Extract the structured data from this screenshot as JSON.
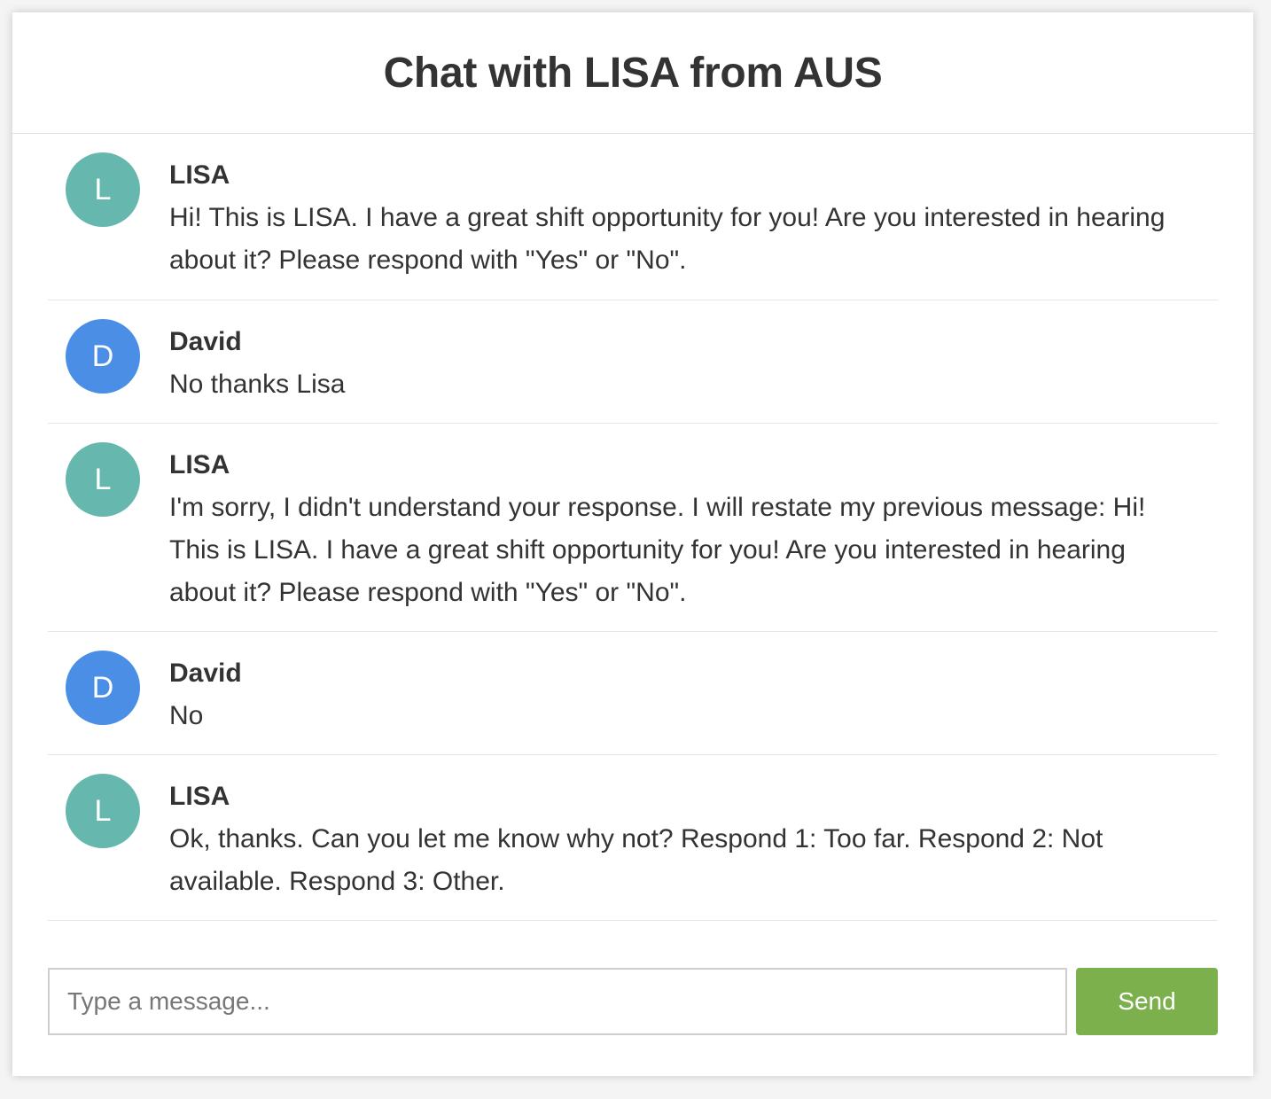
{
  "header": {
    "title": "Chat with LISA from AUS"
  },
  "colors": {
    "lisa_avatar": "#66b7ae",
    "david_avatar": "#4a8ee6",
    "send_button": "#7bb04c"
  },
  "messages": [
    {
      "initial": "L",
      "sender": "LISA",
      "text": "Hi! This is LISA. I have a great shift opportunity for you! Are you interested in hearing about it? Please respond with \"Yes\" or \"No\"."
    },
    {
      "initial": "D",
      "sender": "David",
      "text": "No thanks Lisa"
    },
    {
      "initial": "L",
      "sender": "LISA",
      "text": "I'm sorry, I didn't understand your response. I will restate my previous message: Hi! This is LISA. I have a great shift opportunity for you! Are you interested in hearing about it? Please respond with \"Yes\" or \"No\"."
    },
    {
      "initial": "D",
      "sender": "David",
      "text": "No"
    },
    {
      "initial": "L",
      "sender": "LISA",
      "text": "Ok, thanks. Can you let me know why not? Respond 1: Too far. Respond 2: Not available. Respond 3: Other."
    }
  ],
  "composer": {
    "placeholder": "Type a message...",
    "value": "",
    "send_label": "Send"
  }
}
